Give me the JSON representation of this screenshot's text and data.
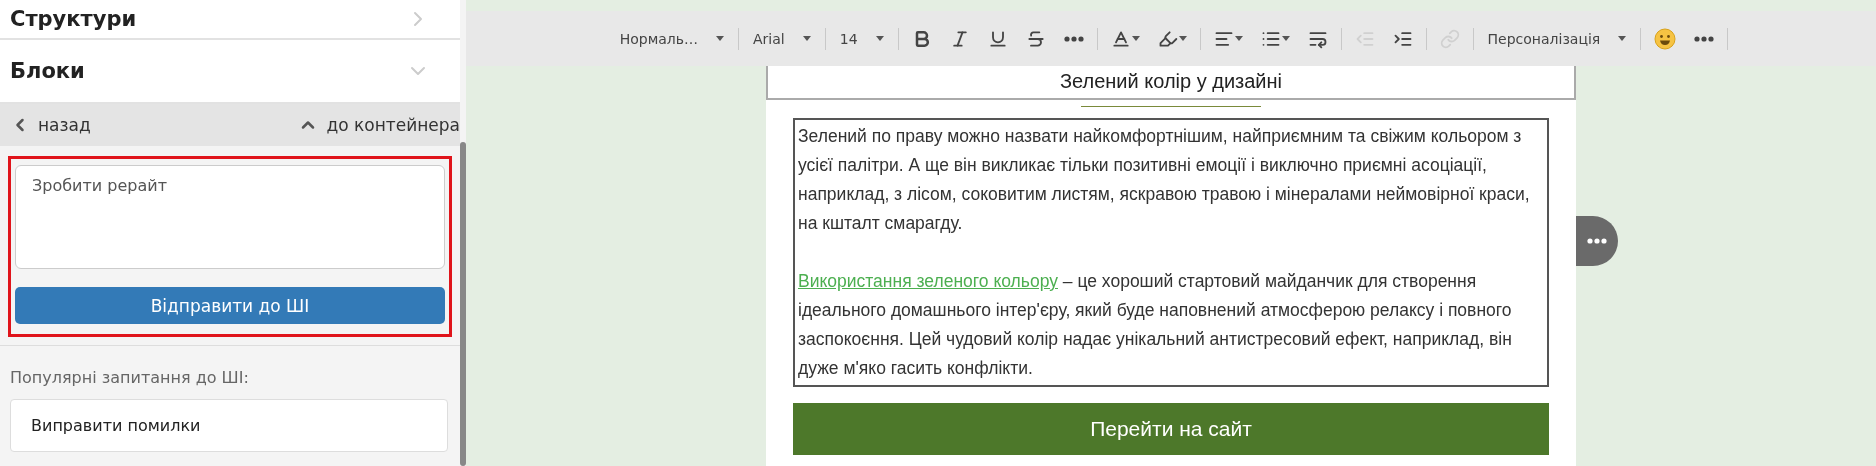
{
  "sidebar": {
    "sections": [
      {
        "title": "Структури",
        "expanded": false
      },
      {
        "title": "Блоки",
        "expanded": true
      }
    ],
    "nav": {
      "back": "назад",
      "up": "до контейнера"
    },
    "ai_prompt": {
      "value": "Зробити рерайт",
      "button": "Відправити до ШІ",
      "highlighted": true
    },
    "popular": {
      "title": "Популярні запитання до ШІ:",
      "items": [
        "Виправити помилки"
      ]
    }
  },
  "toolbar": {
    "items": [
      {
        "kind": "dropdown",
        "label": "Нормаль…"
      },
      {
        "kind": "separator"
      },
      {
        "kind": "dropdown",
        "label": "Arial"
      },
      {
        "kind": "separator"
      },
      {
        "kind": "dropdown",
        "label": "14"
      },
      {
        "kind": "separator"
      },
      {
        "kind": "button",
        "disabled": false
      },
      {
        "kind": "button",
        "disabled": false
      },
      {
        "kind": "button",
        "disabled": false
      },
      {
        "kind": "button",
        "disabled": false
      },
      {
        "kind": "button",
        "disabled": false
      },
      {
        "kind": "separator"
      },
      {
        "kind": "menu",
        "disabled": false
      },
      {
        "kind": "menu",
        "disabled": false
      },
      {
        "kind": "separator"
      },
      {
        "kind": "menu",
        "disabled": false
      },
      {
        "kind": "menu",
        "disabled": false
      },
      {
        "kind": "button",
        "disabled": false
      },
      {
        "kind": "separator"
      },
      {
        "kind": "button",
        "disabled": true
      },
      {
        "kind": "button",
        "disabled": false
      },
      {
        "kind": "separator"
      },
      {
        "kind": "button",
        "disabled": true
      },
      {
        "kind": "separator"
      },
      {
        "kind": "dropdown",
        "label": "Персоналізація"
      },
      {
        "kind": "separator"
      },
      {
        "kind": "button",
        "disabled": false
      },
      {
        "kind": "button",
        "disabled": false
      },
      {
        "kind": "separator"
      }
    ]
  },
  "content": {
    "heading": "Зелений колір у дизайні",
    "paragraphs": [
      {
        "text": "Зелений по праву можно назвати найкомфортнішим, найприємним та свіжим кольором з усієї палітри. А ще він викликає тільки позитивні емоції і виключно приємні асоціації, наприклад, з лісом, соковитим листям, яскравою травою і мінералами неймовірної краси, на кшталт смарагду."
      },
      {
        "link": "Використання зеленого кольору",
        "text": " – це хороший стартовий майданчик для створення ідеального домашнього інтер'єру, який буде наповнений атмосферою релаксу і повного заспокоєння. Цей чудовий колір надає унікальний антистресовий ефект, наприклад, він дуже м'яко гасить конфлікти."
      }
    ],
    "cta": "Перейти на сайт"
  }
}
